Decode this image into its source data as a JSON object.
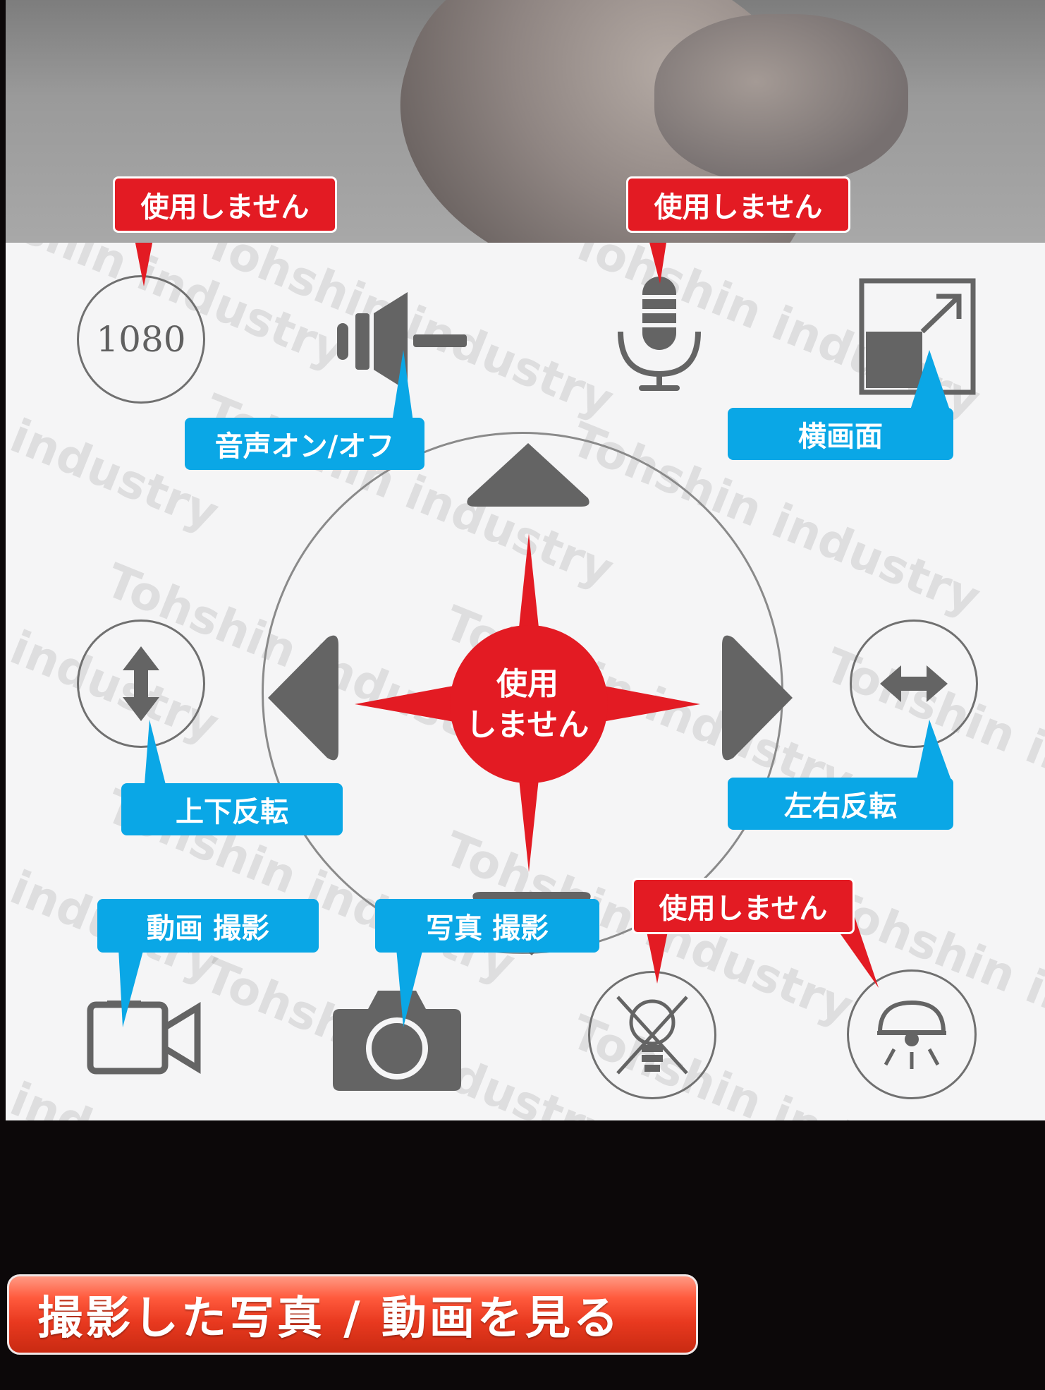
{
  "panel": {
    "watermark": "Tohshin industry",
    "resolution_label": "1080"
  },
  "callouts": {
    "resolution_unused": "使用しません",
    "mic_unused": "使用しません",
    "audio_toggle": "音声オン/オフ",
    "landscape": "横画面",
    "center_unused": "使用\nしません",
    "flip_vertical": "上下反転",
    "flip_horizontal": "左右反転",
    "video_record": "動画 撮影",
    "photo_capture": "写真 撮影",
    "light_unused": "使用しません"
  },
  "footer": {
    "gallery_button_label": "撮影した写真 / 動画を見る"
  },
  "colors": {
    "red_callout": "#e31b23",
    "blue_callout": "#0aa7e6",
    "icon_gray": "#646464"
  }
}
